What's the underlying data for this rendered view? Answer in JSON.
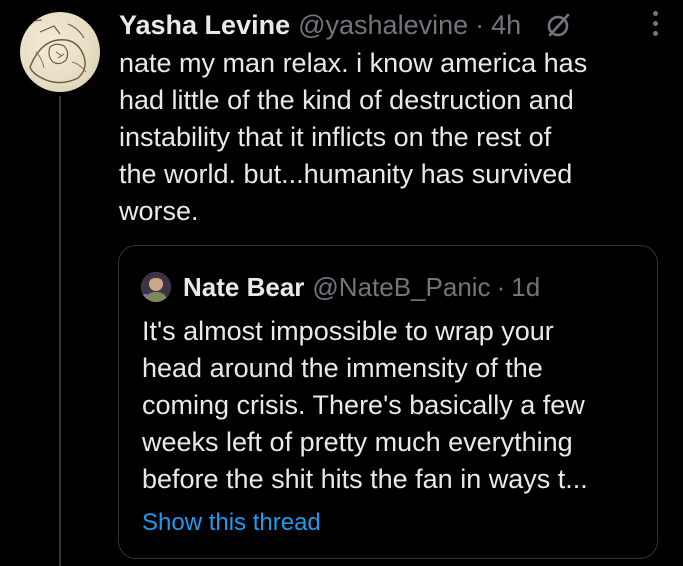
{
  "tweet": {
    "display_name": "Yasha Levine",
    "handle": "@yashalevine",
    "separator": "·",
    "time": "4h",
    "text_lines": [
      "nate my man relax. i know america has",
      "had little of the kind of destruction and",
      "instability that it inflicts on the rest of",
      "the world. but...humanity has survived",
      "worse."
    ],
    "avatar_icon": "sketch-avatar",
    "grok_icon": "grok-slash-circle-icon",
    "more_icon": "more-vertical-icon"
  },
  "quote": {
    "display_name": "Nate Bear",
    "handle": "@NateB_Panic",
    "separator": "·",
    "time": "1d",
    "text_lines": [
      "It's almost impossible to wrap your",
      "head around the immensity of the",
      "coming crisis. There's basically a few",
      "weeks left of pretty much everything",
      "before the shit hits the fan in ways t..."
    ],
    "show_thread": "Show this thread"
  },
  "colors": {
    "background": "#000000",
    "text_primary": "#e7e9ea",
    "text_secondary": "#71767b",
    "border": "#2f3336",
    "link": "#1d9bf0"
  }
}
